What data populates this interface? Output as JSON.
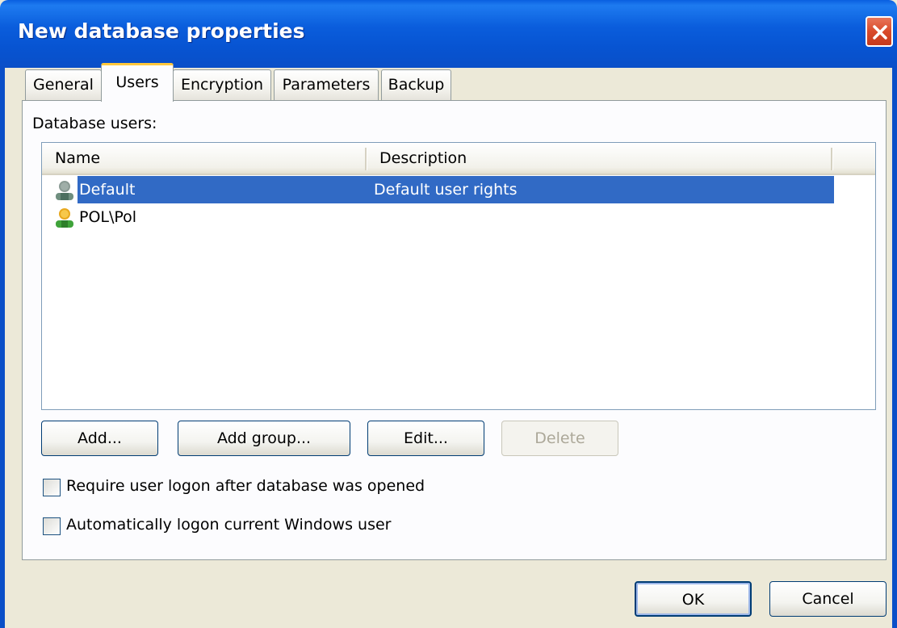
{
  "window": {
    "title": "New database properties",
    "close_icon": "close-icon"
  },
  "tabs": [
    {
      "label": "General",
      "active": false
    },
    {
      "label": "Users",
      "active": true
    },
    {
      "label": "Encryption",
      "active": false
    },
    {
      "label": "Parameters",
      "active": false
    },
    {
      "label": "Backup",
      "active": false
    }
  ],
  "users_page": {
    "list_label": "Database users:",
    "columns": [
      "Name",
      "Description"
    ],
    "rows": [
      {
        "name": "Default",
        "description": "Default user rights",
        "icon": "user-gray-icon",
        "selected": true
      },
      {
        "name": "POL\\Pol",
        "description": "",
        "icon": "user-yellow-icon",
        "selected": false
      }
    ],
    "buttons": {
      "add": "Add...",
      "add_group": "Add group...",
      "edit": "Edit...",
      "delete": "Delete"
    },
    "checkboxes": [
      {
        "label": "Require user logon after database was opened",
        "checked": false
      },
      {
        "label": "Automatically logon current Windows user",
        "checked": false
      }
    ]
  },
  "footer": {
    "ok": "OK",
    "cancel": "Cancel"
  },
  "colors": {
    "title_bar": "#0A5DDC",
    "selection": "#316AC5",
    "dialog_bg": "#ECE9D8",
    "active_tab_accent": "#FFC83C"
  }
}
